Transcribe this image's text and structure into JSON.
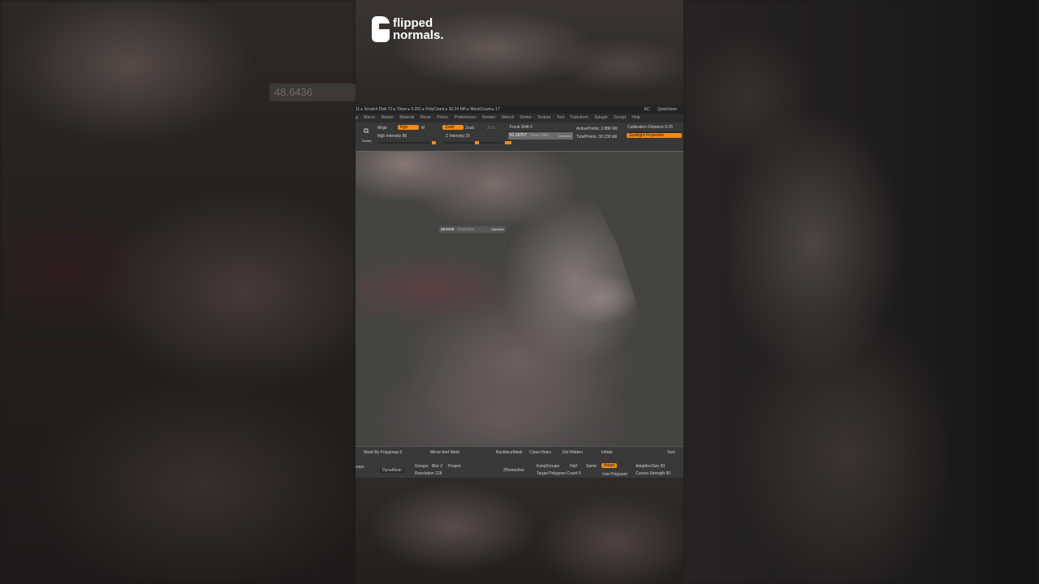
{
  "brand": {
    "line1": "flipped",
    "line2": "normals."
  },
  "background_ghost_value": "48.6436",
  "status_bar": {
    "left": "11 ▸ Scratch Disk 72 ▸ Timer ▸ 0.001 ▸ PolyCount ▸ 30.24 MP ▸ MeshCount ▸ 17",
    "right_items": [
      "AC",
      "QuickSave"
    ]
  },
  "menu_items": [
    "g",
    "Macro",
    "Marker",
    "Material",
    "Movie",
    "Picker",
    "Preferences",
    "Render",
    "Stencil",
    "Stroke",
    "Texture",
    "Tool",
    "Transform",
    "Zplugin",
    "Zscript",
    "Help"
  ],
  "toolbar": {
    "rotate": "Rotate",
    "mrgb": "Mrgb",
    "rgb": "Rgb",
    "m": "M",
    "zadd": "Zadd",
    "zsub": "Zsub",
    "zcut": "Zcut",
    "rgb_intensity": "Rgb Intensity 86",
    "z_intensity": "Z Intensity 25",
    "focal_shift": "Focal Shift 0",
    "draw_size_value": "51.16757",
    "draw_size_label": "Draw Size",
    "dynamic": "Dynamic",
    "active_points": "ActivePoints: 2.886 Mil",
    "total_points": "TotalPoints: 30.238 Mil",
    "calibration": "Calibration Distance 0.25",
    "spotlight": "Spotlight Projection"
  },
  "viewport_popup": {
    "value": "48.6436",
    "label": "Draw Size",
    "dynamic": "Dynamic"
  },
  "bottom_panel": {
    "mask_by_polygroup": "Mask By Polygroup 0",
    "mirror_and_weld": "Mirror And Weld",
    "backface_mask": "BackfaceMask",
    "close_holes": "Close Holes",
    "del_hidden": "Del Hidden",
    "inflate": "Inflate",
    "size": "Size",
    "snapo": "snpo",
    "dynamesh": "DynaMesh",
    "groups": "Groups",
    "blur": "Blur 2",
    "project": "Project",
    "resolution": "Resolution 128",
    "zremesher": "ZRemesher",
    "keep_groups": "KeepGroups",
    "half": "Half",
    "same": "Same",
    "adapt": "Adapt",
    "adaptive_size": "AdaptiveSize 50",
    "target_poly": "Target Polygons Count 5",
    "use_polypaint": "Use Polypaint",
    "curves_strength": "Curves Strength 50"
  }
}
